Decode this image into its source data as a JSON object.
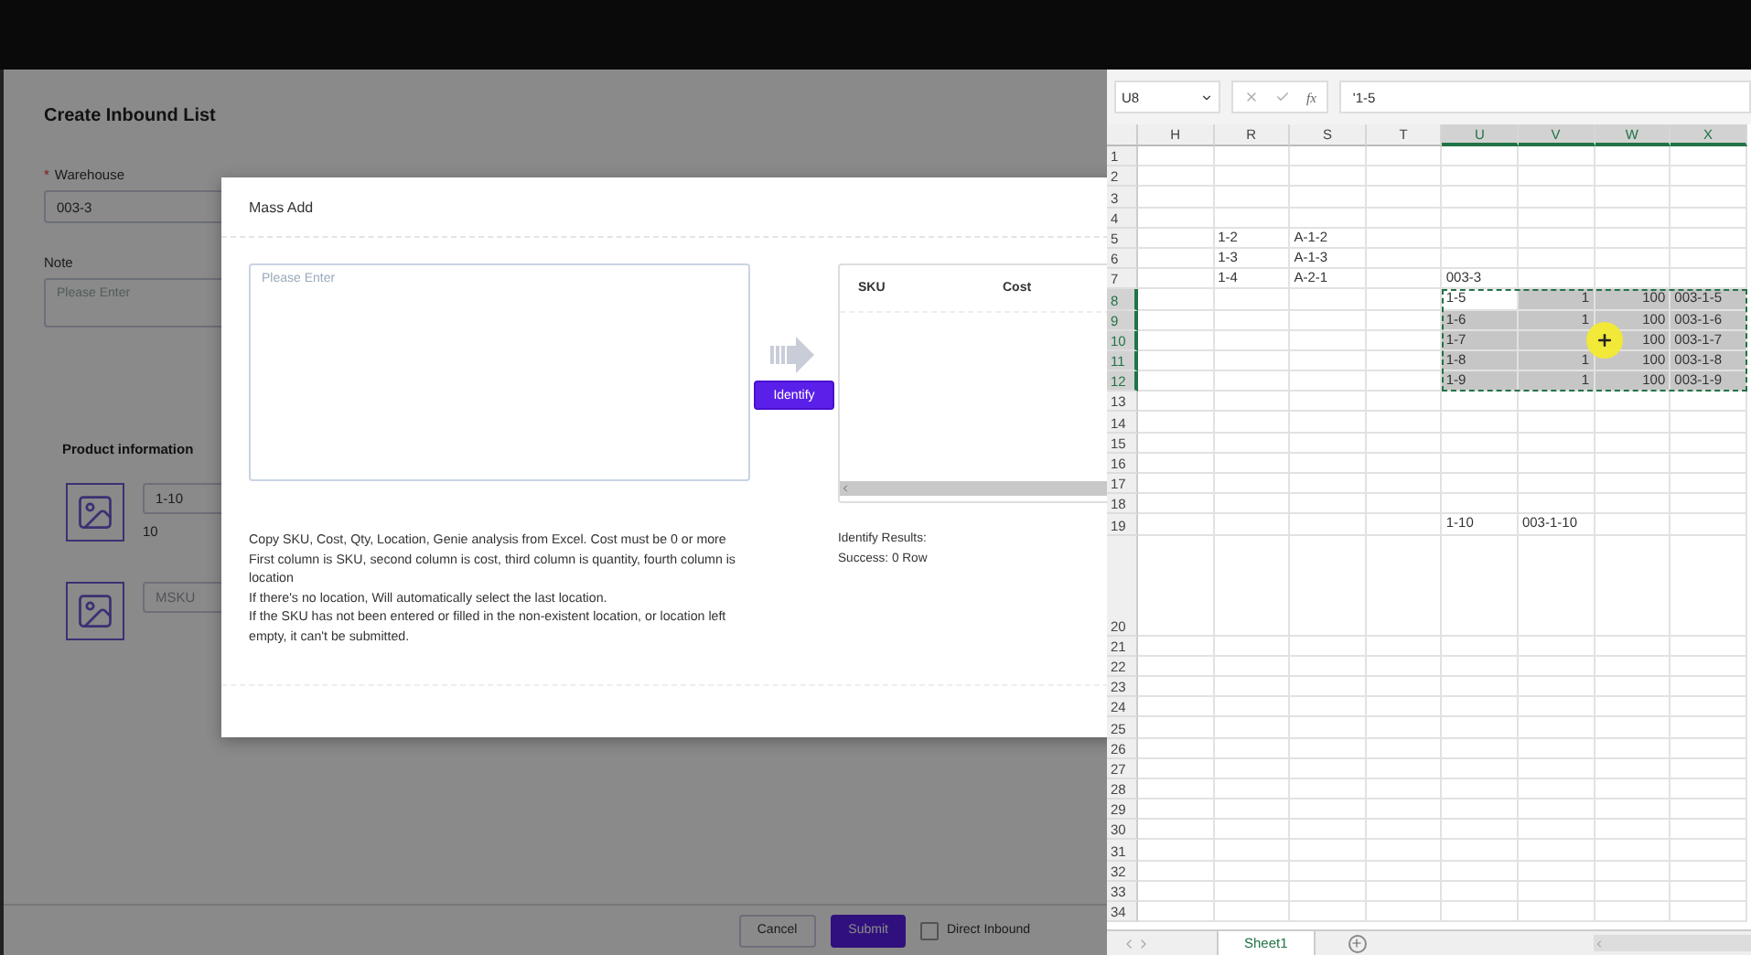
{
  "page": {
    "title": "Create Inbound List",
    "warehouse": {
      "label": "Warehouse",
      "required": true,
      "required_mark": "*",
      "value": "003-3"
    },
    "note": {
      "label": "Note",
      "placeholder": "Please Enter"
    },
    "product_section": {
      "title": "Product information",
      "products": [
        {
          "sku": "1-10",
          "qty": "10"
        },
        {
          "placeholder": "MSKU"
        }
      ]
    },
    "footer": {
      "cancel": "Cancel",
      "submit": "Submit",
      "direct_inbound": {
        "label": "Direct Inbound",
        "checked": false
      }
    }
  },
  "modal": {
    "title": "Mass Add",
    "input": {
      "placeholder": "Please Enter"
    },
    "identify_button": "Identify",
    "result_table": {
      "columns": [
        "SKU",
        "Cost"
      ]
    },
    "instructions": [
      "Copy SKU, Cost, Qty, Location, Genie analysis from Excel. Cost must be 0 or more",
      "First column is SKU, second column is cost, third column is quantity, fourth column is location",
      "If there's no location, Will automatically select the last location.",
      "If the SKU has not been entered or filled in the non-existent location, or location left empty, it can't be submitted."
    ],
    "results": [
      "Identify Results:",
      "Success: 0 Row"
    ]
  },
  "spreadsheet": {
    "name_box": "U8",
    "function_label": "fx",
    "formula": "'1-5",
    "columns": [
      {
        "label": "H",
        "selected": false
      },
      {
        "label": "R",
        "selected": false
      },
      {
        "label": "S",
        "selected": false
      },
      {
        "label": "T",
        "selected": false
      },
      {
        "label": "U",
        "selected": true
      },
      {
        "label": "V",
        "selected": true
      },
      {
        "label": "W",
        "selected": true
      },
      {
        "label": "X",
        "selected": true
      }
    ],
    "rows": [
      {
        "label": "1",
        "selected": false,
        "cells": []
      },
      {
        "label": "2",
        "selected": false,
        "cells": []
      },
      {
        "label": "3",
        "selected": false,
        "cells": []
      },
      {
        "label": "4",
        "selected": false,
        "cells": []
      },
      {
        "label": "5",
        "selected": false,
        "cells": [
          null,
          {
            "text": "1-2"
          },
          {
            "text": "A-1-2"
          }
        ]
      },
      {
        "label": "6",
        "selected": false,
        "cells": [
          null,
          {
            "text": "1-3"
          },
          {
            "text": "A-1-3"
          }
        ]
      },
      {
        "label": "7",
        "selected": false,
        "cells": [
          null,
          {
            "text": "1-4"
          },
          {
            "text": "A-2-1"
          },
          null,
          {
            "text": "003-3"
          }
        ]
      },
      {
        "label": "8",
        "selected": true,
        "cells": [
          null,
          null,
          null,
          null,
          {
            "text": "1-5",
            "active": true
          },
          {
            "text": "1",
            "kind": "number"
          },
          {
            "text": "100",
            "kind": "number"
          },
          {
            "text": "003-1-5"
          }
        ]
      },
      {
        "label": "9",
        "selected": true,
        "cells": [
          null,
          null,
          null,
          null,
          {
            "text": "1-6"
          },
          {
            "text": "1",
            "kind": "number"
          },
          {
            "text": "100",
            "kind": "number"
          },
          {
            "text": "003-1-6"
          }
        ]
      },
      {
        "label": "10",
        "selected": true,
        "cells": [
          null,
          null,
          null,
          null,
          {
            "text": "1-7"
          },
          null,
          {
            "text": "100",
            "kind": "number"
          },
          {
            "text": "003-1-7"
          }
        ],
        "cursor": true
      },
      {
        "label": "11",
        "selected": true,
        "cells": [
          null,
          null,
          null,
          null,
          {
            "text": "1-8"
          },
          {
            "text": "1",
            "kind": "number"
          },
          {
            "text": "100",
            "kind": "number"
          },
          {
            "text": "003-1-8"
          }
        ]
      },
      {
        "label": "12",
        "selected": true,
        "cells": [
          null,
          null,
          null,
          null,
          {
            "text": "1-9"
          },
          {
            "text": "1",
            "kind": "number"
          },
          {
            "text": "100",
            "kind": "number"
          },
          {
            "text": "003-1-9"
          }
        ]
      },
      {
        "label": "13",
        "selected": false,
        "cells": []
      },
      {
        "label": "14",
        "selected": false,
        "cells": []
      },
      {
        "label": "15",
        "selected": false,
        "cells": []
      },
      {
        "label": "16",
        "selected": false,
        "cells": []
      },
      {
        "label": "17",
        "selected": false,
        "cells": []
      },
      {
        "label": "18",
        "selected": false,
        "cells": []
      },
      {
        "label": "19",
        "selected": false,
        "cells": [
          null,
          null,
          null,
          null,
          {
            "text": "1-10"
          },
          {
            "text": "003-1-10"
          }
        ]
      },
      {
        "label": "20",
        "selected": false,
        "kind": "tall",
        "cells": []
      },
      {
        "label": "21",
        "selected": false,
        "cells": []
      },
      {
        "label": "22",
        "selected": false,
        "cells": []
      },
      {
        "label": "23",
        "selected": false,
        "cells": []
      },
      {
        "label": "24",
        "selected": false,
        "cells": []
      },
      {
        "label": "25",
        "selected": false,
        "cells": []
      },
      {
        "label": "26",
        "selected": false,
        "cells": []
      },
      {
        "label": "27",
        "selected": false,
        "cells": []
      },
      {
        "label": "28",
        "selected": false,
        "cells": []
      },
      {
        "label": "29",
        "selected": false,
        "cells": []
      },
      {
        "label": "30",
        "selected": false,
        "cells": []
      },
      {
        "label": "31",
        "selected": false,
        "cells": []
      },
      {
        "label": "32",
        "selected": false,
        "cells": []
      },
      {
        "label": "33",
        "selected": false,
        "cells": []
      },
      {
        "label": "34",
        "selected": false,
        "cells": []
      }
    ],
    "sheets": [
      {
        "label": "Sheet1",
        "selected": true
      }
    ]
  }
}
